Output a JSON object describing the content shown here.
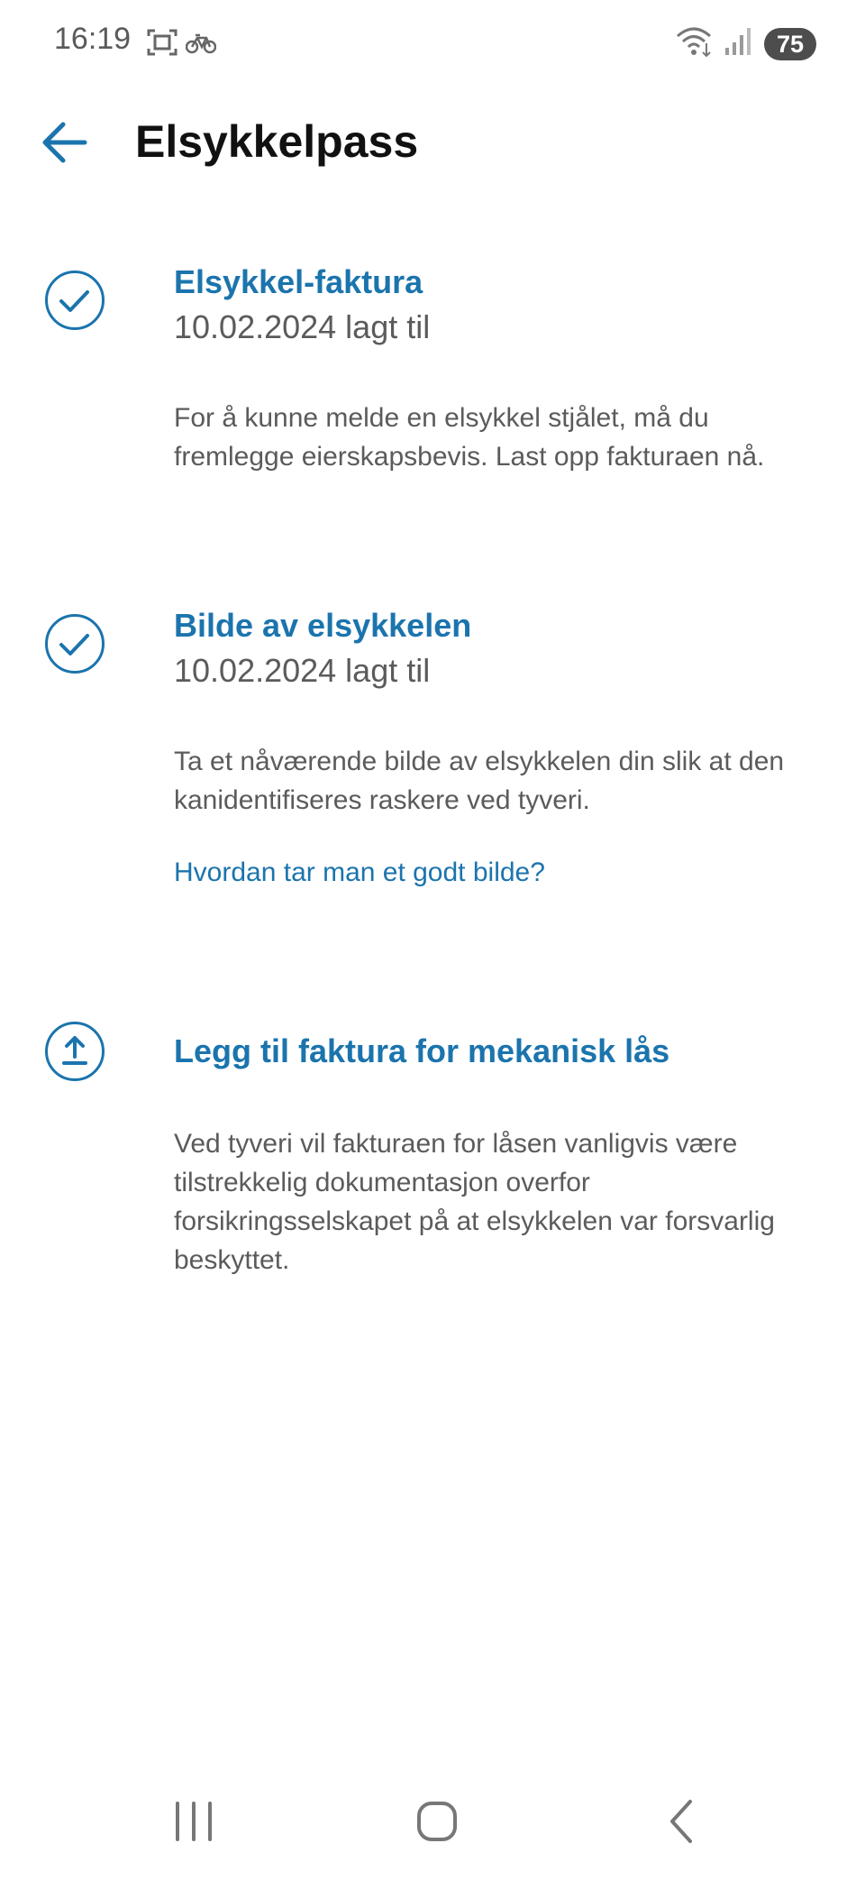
{
  "status_bar": {
    "time": "16:19",
    "left_icons": [
      "screenshot-icon",
      "bicycle-icon"
    ],
    "right_icons": [
      "wifi-icon",
      "signal-icon"
    ],
    "battery": "75"
  },
  "app_bar": {
    "back_icon": "arrow-left-icon",
    "title": "Elsykkelpass"
  },
  "sections": [
    {
      "status_icon": "check-circle-icon",
      "title": "Elsykkel-faktura",
      "date": "10.02.2024 lagt til",
      "description": "For å kunne melde en elsykkel stjålet, må du fremlegge eierskapsbevis. Last opp fakturaen nå."
    },
    {
      "status_icon": "check-circle-icon",
      "title": "Bilde av elsykkelen",
      "date": "10.02.2024 lagt til",
      "description": "Ta et nåværende bilde av elsykkelen din slik at den kanidentifiseres raskere ved tyveri.",
      "link": "Hvordan tar man et godt bilde?"
    },
    {
      "status_icon": "upload-circle-icon",
      "title": "Legg til faktura for mekanisk lås",
      "description": "Ved tyveri vil fakturaen for låsen vanligvis være tilstrekkelig dokumentasjon overfor forsikringsselskapet på at elsykkelen var forsvarlig beskyttet."
    }
  ],
  "nav_bar": {
    "buttons": [
      "recent-apps-icon",
      "home-icon",
      "back-icon"
    ]
  },
  "colors": {
    "accent": "#1b74ad",
    "text_secondary": "#5b5b5b",
    "title": "#111111",
    "background": "#ffffff"
  }
}
